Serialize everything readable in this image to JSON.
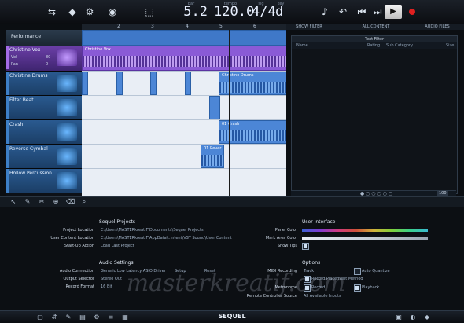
{
  "transport": {
    "position": "5.2",
    "position_caption": "bar",
    "tempo": "120.0",
    "tempo_caption": "tempo",
    "signature": "4/4",
    "signature_caption": "sig",
    "key": "d",
    "key_caption": "key"
  },
  "ruler": {
    "marks": [
      "2",
      "3",
      "4",
      "5",
      "6"
    ]
  },
  "tracks": [
    {
      "name": "Performance"
    },
    {
      "name": "Christine Vox",
      "vol_label": "Vol",
      "vol": "80",
      "pan_label": "Pan",
      "pan": "0"
    },
    {
      "name": "Christine Drums"
    },
    {
      "name": "Filter Beat"
    },
    {
      "name": "Crash"
    },
    {
      "name": "Reverse Cymbal"
    },
    {
      "name": "Hollow Percussion"
    }
  ],
  "clips": {
    "vox": "Christine Vox",
    "drums": "Christine Drums",
    "crash": "01 Crash",
    "reverse": "01 Rever"
  },
  "right_tabs": [
    "SHOW FILTER",
    "ALL CONTENT",
    "AUDIO FILES"
  ],
  "media": {
    "header": "Text Filter",
    "columns": [
      "Name",
      "Rating",
      "Sub Category",
      "Size"
    ],
    "zoom": "100"
  },
  "brand": "SEQUEL",
  "settings": {
    "projects_title": "Sequel Projects",
    "project_location_label": "Project Location",
    "project_location": "C:\\Users\\MASTERkreatiF\\Documents\\Sequel Projects",
    "user_content_label": "User Content Location",
    "user_content": "C:\\Users\\MASTERkreatiF\\AppData\\...ntent\\VST Sound\\User Content",
    "startup_label": "Start-Up Action",
    "startup": "Load Last Project",
    "audio_title": "Audio Settings",
    "audio_conn_label": "Audio Connection",
    "audio_conn": "Generic Low Latency ASIO Driver",
    "setup_btn": "Setup",
    "reset_btn": "Reset",
    "output_label": "Output Selector",
    "output": "Stereo Out",
    "record_label": "Record Format",
    "record": "16 Bit",
    "ui_title": "User Interface",
    "panel_color_label": "Panel Color",
    "mark_area_label": "Mark Area Color",
    "show_tips_label": "Show Tips",
    "options_title": "Options",
    "midi_rec_label": "MIDI Recording",
    "midi_rec_opt1": "Track",
    "midi_rec_opt2": "Auto Quantize",
    "midi_method": "Record Placement Method",
    "metronome_label": "Metronome",
    "metronome_opt1": "Record",
    "metronome_opt2": "Playback",
    "remote_label": "Remote Controller Source",
    "remote": "All Available Inputs"
  },
  "watermark": "masterkreatif.com",
  "colors": {
    "accent": "#2b8ac9",
    "track": "#2a5a90",
    "clip_purple": "#8a5ad6",
    "clip_blue": "#4c86d6"
  }
}
